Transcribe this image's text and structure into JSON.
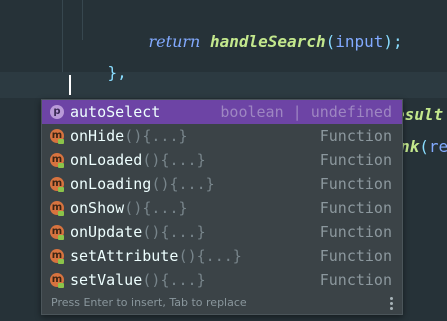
{
  "editor": {
    "line1": {
      "keyword": "return",
      "function_name": "handleSearch",
      "open_paren": "(",
      "argument": "input",
      "close": ");"
    },
    "line2": {
      "close_brace": "}",
      "comma": ","
    },
    "behind_popup": {
      "result_fragment": "esult",
      "call_fragment": "nk",
      "paren": "(",
      "arg_fragment": "re"
    }
  },
  "autocomplete": {
    "items": [
      {
        "icon": "property-icon",
        "icon_letter": "p",
        "name": "autoSelect",
        "tail": "",
        "type": "boolean | undefined",
        "selected": true
      },
      {
        "icon": "method-icon",
        "icon_letter": "m",
        "name": "onHide",
        "tail": "(){...}",
        "type": "Function",
        "selected": false
      },
      {
        "icon": "method-icon",
        "icon_letter": "m",
        "name": "onLoaded",
        "tail": "(){...}",
        "type": "Function",
        "selected": false
      },
      {
        "icon": "method-icon",
        "icon_letter": "m",
        "name": "onLoading",
        "tail": "(){...}",
        "type": "Function",
        "selected": false
      },
      {
        "icon": "method-icon",
        "icon_letter": "m",
        "name": "onShow",
        "tail": "(){...}",
        "type": "Function",
        "selected": false
      },
      {
        "icon": "method-icon",
        "icon_letter": "m",
        "name": "onUpdate",
        "tail": "(){...}",
        "type": "Function",
        "selected": false
      },
      {
        "icon": "method-icon",
        "icon_letter": "m",
        "name": "setAttribute",
        "tail": "(){...}",
        "type": "Function",
        "selected": false
      },
      {
        "icon": "method-icon",
        "icon_letter": "m",
        "name": "setValue",
        "tail": "(){...}",
        "type": "Function",
        "selected": false
      }
    ],
    "hint": "Press Enter to insert, Tab to replace",
    "menu_icon": "vertical-ellipsis-icon"
  },
  "colors": {
    "background": "#263238",
    "selected_item": "#6d44a5",
    "popup_background": "#3b4347",
    "keyword": "#82aaff",
    "function": "#c3e88d",
    "punctuation": "#89ddff",
    "method_icon": "#d7733f",
    "property_icon": "#b99ad8"
  }
}
